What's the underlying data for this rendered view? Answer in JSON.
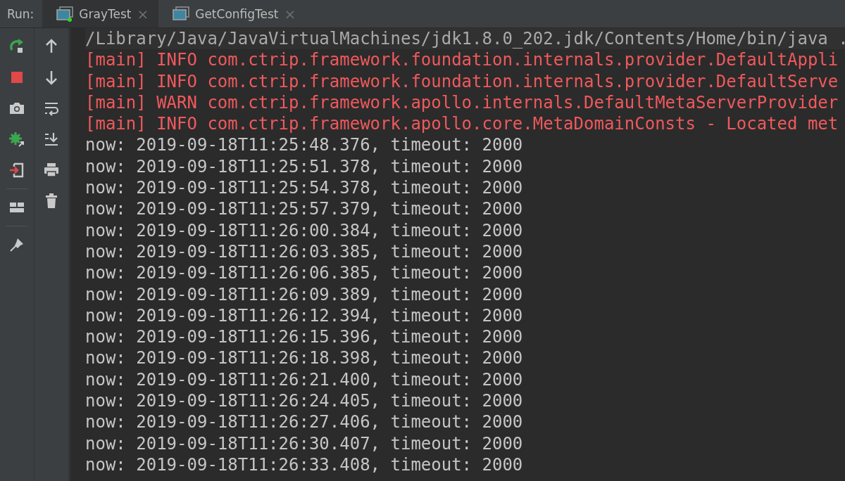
{
  "run_label": "Run:",
  "tabs": [
    {
      "label": "GrayTest",
      "selected": true,
      "running": true,
      "close": "×"
    },
    {
      "label": "GetConfigTest",
      "selected": false,
      "running": false,
      "close": "×"
    }
  ],
  "console_lines": [
    {
      "kind": "command",
      "text": "/Library/Java/JavaVirtualMachines/jdk1.8.0_202.jdk/Contents/Home/bin/java ."
    },
    {
      "kind": "log",
      "text": "[main] INFO com.ctrip.framework.foundation.internals.provider.DefaultAppli"
    },
    {
      "kind": "log",
      "text": "[main] INFO com.ctrip.framework.foundation.internals.provider.DefaultServe"
    },
    {
      "kind": "log",
      "text": "[main] WARN com.ctrip.framework.apollo.internals.DefaultMetaServerProvider"
    },
    {
      "kind": "log",
      "text": "[main] INFO com.ctrip.framework.apollo.core.MetaDomainConsts - Located met"
    },
    {
      "kind": "output",
      "text": "now: 2019-09-18T11:25:48.376, timeout: 2000"
    },
    {
      "kind": "output",
      "text": "now: 2019-09-18T11:25:51.378, timeout: 2000"
    },
    {
      "kind": "output",
      "text": "now: 2019-09-18T11:25:54.378, timeout: 2000"
    },
    {
      "kind": "output",
      "text": "now: 2019-09-18T11:25:57.379, timeout: 2000"
    },
    {
      "kind": "output",
      "text": "now: 2019-09-18T11:26:00.384, timeout: 2000"
    },
    {
      "kind": "output",
      "text": "now: 2019-09-18T11:26:03.385, timeout: 2000"
    },
    {
      "kind": "output",
      "text": "now: 2019-09-18T11:26:06.385, timeout: 2000"
    },
    {
      "kind": "output",
      "text": "now: 2019-09-18T11:26:09.389, timeout: 2000"
    },
    {
      "kind": "output",
      "text": "now: 2019-09-18T11:26:12.394, timeout: 2000"
    },
    {
      "kind": "output",
      "text": "now: 2019-09-18T11:26:15.396, timeout: 2000"
    },
    {
      "kind": "output",
      "text": "now: 2019-09-18T11:26:18.398, timeout: 2000"
    },
    {
      "kind": "output",
      "text": "now: 2019-09-18T11:26:21.400, timeout: 2000"
    },
    {
      "kind": "output",
      "text": "now: 2019-09-18T11:26:24.405, timeout: 2000"
    },
    {
      "kind": "output",
      "text": "now: 2019-09-18T11:26:27.406, timeout: 2000"
    },
    {
      "kind": "output",
      "text": "now: 2019-09-18T11:26:30.407, timeout: 2000"
    },
    {
      "kind": "output",
      "text": "now: 2019-09-18T11:26:33.408, timeout: 2000"
    }
  ]
}
